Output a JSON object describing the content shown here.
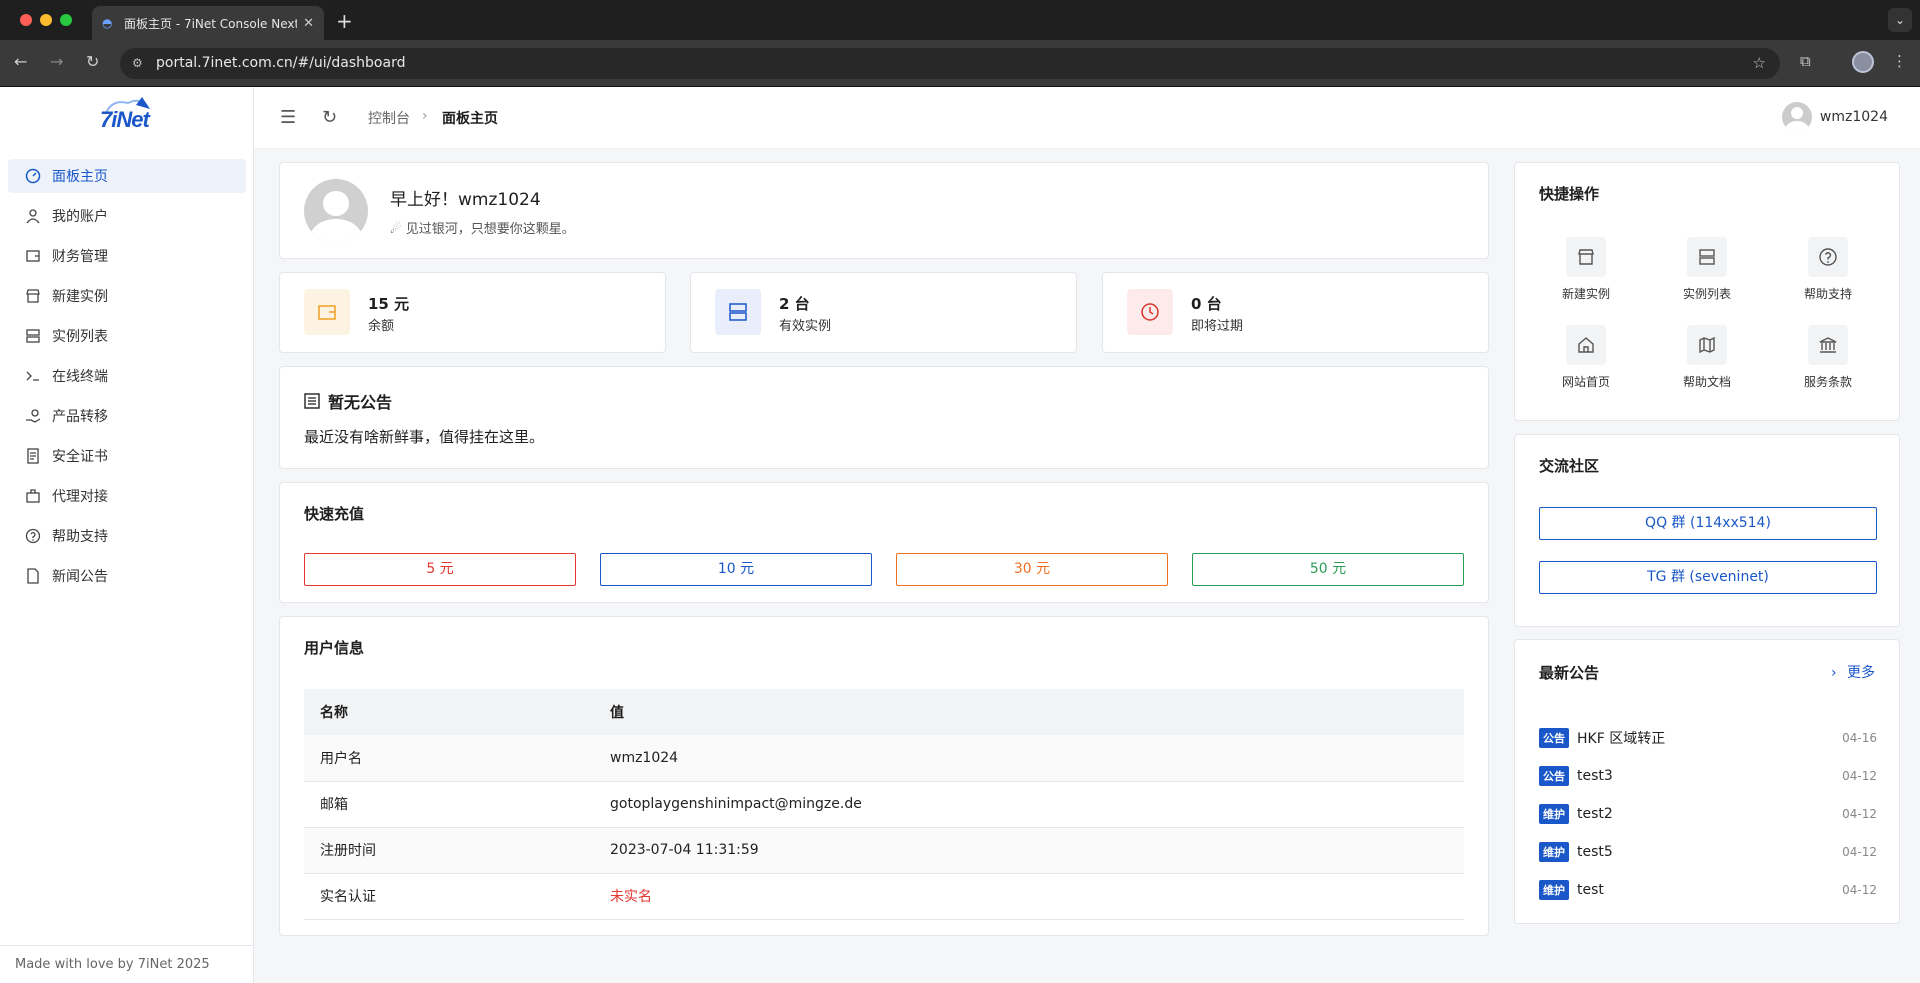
{
  "browser": {
    "tab_title": "面板主页 - 7iNet Console Next",
    "url": "portal.7inet.com.cn/#/ui/dashboard"
  },
  "sidebar": {
    "logo_text": "7iNet",
    "items": [
      {
        "label": "面板主页",
        "icon": "dashboard-icon",
        "active": true
      },
      {
        "label": "我的账户",
        "icon": "user-icon"
      },
      {
        "label": "财务管理",
        "icon": "wallet-icon"
      },
      {
        "label": "新建实例",
        "icon": "store-icon"
      },
      {
        "label": "实例列表",
        "icon": "server-icon"
      },
      {
        "label": "在线终端",
        "icon": "terminal-icon"
      },
      {
        "label": "产品转移",
        "icon": "transfer-icon"
      },
      {
        "label": "安全证书",
        "icon": "certificate-icon"
      },
      {
        "label": "代理对接",
        "icon": "briefcase-icon"
      },
      {
        "label": "帮助支持",
        "icon": "help-icon"
      },
      {
        "label": "新闻公告",
        "icon": "document-icon"
      }
    ],
    "footer": "Made with love by 7iNet 2025"
  },
  "topbar": {
    "breadcrumb_root": "控制台",
    "breadcrumb_current": "面板主页",
    "username": "wmz1024"
  },
  "welcome": {
    "greeting": "早上好！wmz1024",
    "motto": "见过银河，只想要你这颗星。"
  },
  "stats": [
    {
      "value": "15 元",
      "label": "余额",
      "icon": "wallet-icon",
      "color": "#f0a020"
    },
    {
      "value": "2 台",
      "label": "有效实例",
      "icon": "server-icon",
      "color": "#1a57c8"
    },
    {
      "value": "0 台",
      "label": "即将过期",
      "icon": "clock-icon",
      "color": "#d9362f"
    }
  ],
  "announcement": {
    "title": "暂无公告",
    "body": "最近没有啥新鲜事，值得挂在这里。"
  },
  "recharge": {
    "title": "快速充值",
    "options": [
      {
        "label": "5 元",
        "color": "#e5362f"
      },
      {
        "label": "10 元",
        "color": "#1a57c8"
      },
      {
        "label": "30 元",
        "color": "#f07020"
      },
      {
        "label": "50 元",
        "color": "#2a9d55"
      }
    ]
  },
  "user_info": {
    "title": "用户信息",
    "headers": [
      "名称",
      "值"
    ],
    "rows": [
      {
        "name": "用户名",
        "value": "wmz1024"
      },
      {
        "name": "邮箱",
        "value": "gotoplaygenshinimpact@mingze.de"
      },
      {
        "name": "注册时间",
        "value": "2023-07-04 11:31:59"
      },
      {
        "name": "实名认证",
        "value": "未实名"
      }
    ]
  },
  "quick_actions": {
    "title": "快捷操作",
    "items": [
      {
        "label": "新建实例",
        "icon": "store-icon"
      },
      {
        "label": "实例列表",
        "icon": "server-icon"
      },
      {
        "label": "帮助支持",
        "icon": "help-icon"
      },
      {
        "label": "网站首页",
        "icon": "home-icon"
      },
      {
        "label": "帮助文档",
        "icon": "map-icon"
      },
      {
        "label": "服务条款",
        "icon": "bank-icon"
      }
    ]
  },
  "community": {
    "title": "交流社区",
    "qq": "QQ 群 (114xx514)",
    "tg": "TG 群 (seveninet)"
  },
  "latest_notices": {
    "title": "最新公告",
    "more": "更多",
    "items": [
      {
        "tag": "公告",
        "title": "HKF 区域转正",
        "date": "04-16"
      },
      {
        "tag": "公告",
        "title": "test3",
        "date": "04-12"
      },
      {
        "tag": "维护",
        "title": "test2",
        "date": "04-12"
      },
      {
        "tag": "维护",
        "title": "test5",
        "date": "04-12"
      },
      {
        "tag": "维护",
        "title": "test",
        "date": "04-12"
      }
    ]
  }
}
